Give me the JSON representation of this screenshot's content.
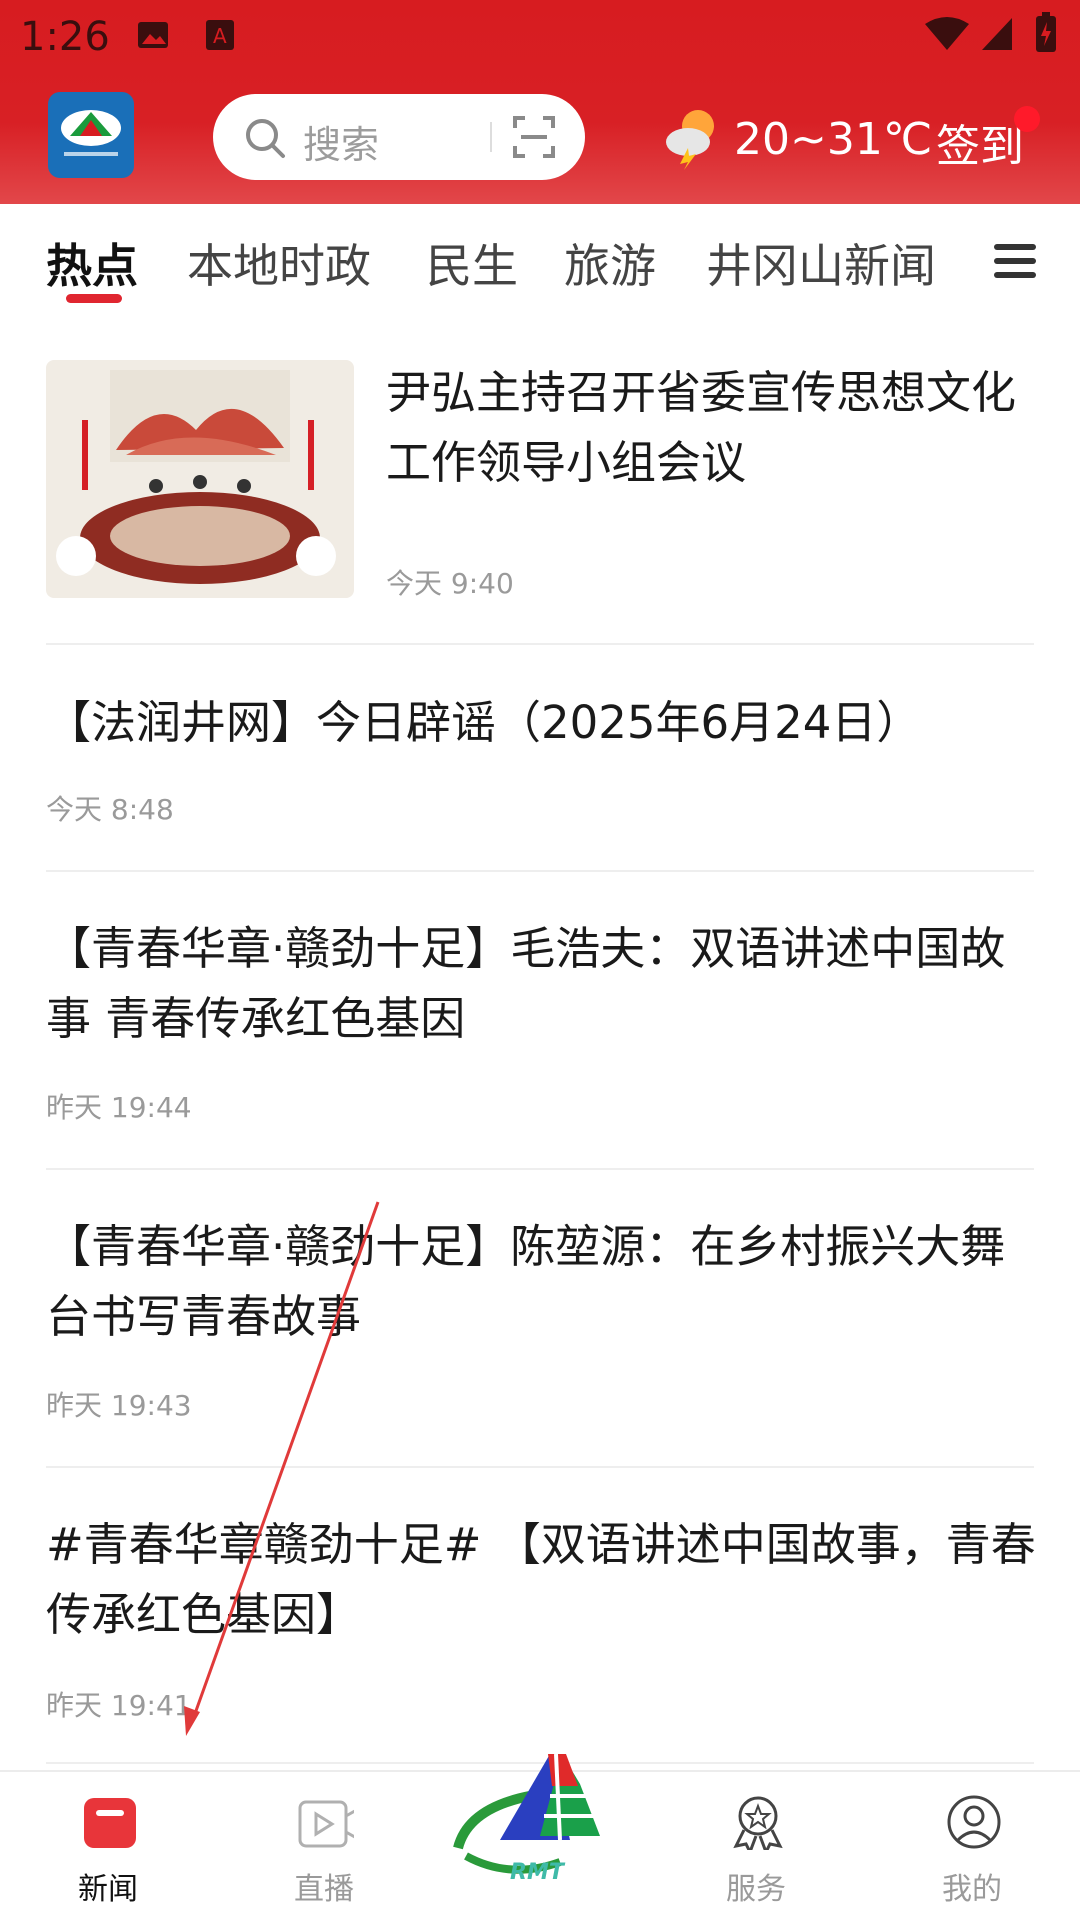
{
  "status_bar": {
    "time": "1:26"
  },
  "header": {
    "search_placeholder": "搜索",
    "weather": "20~31℃",
    "signin_label": "签到"
  },
  "tabs": [
    {
      "label": "热点",
      "active": true
    },
    {
      "label": "本地时政",
      "active": false
    },
    {
      "label": "民生",
      "active": false
    },
    {
      "label": "旅游",
      "active": false
    },
    {
      "label": "井冈山新闻",
      "active": false
    }
  ],
  "news": [
    {
      "title": "尹弘主持召开省委宣传思想文化工作领导小组会议",
      "time": "今天 9:40",
      "has_image": true
    },
    {
      "title": "【法润井网】今日辟谣（2025年6月24日）",
      "time": "今天 8:48"
    },
    {
      "title": "【青春华章·赣劲十足】毛浩夫：双语讲述中国故事 青春传承红色基因",
      "time": "昨天 19:44"
    },
    {
      "title": "【青春华章·赣劲十足】陈堃源：在乡村振兴大舞台书写青春故事",
      "time": "昨天 19:43"
    },
    {
      "title": "#青春华章赣劲十足# 【双语讲述中国故事，青春传承红色基因】",
      "time": "昨天 19:41"
    }
  ],
  "bottom_nav": [
    {
      "label": "新闻",
      "active": true,
      "icon": "news-icon"
    },
    {
      "label": "直播",
      "active": false,
      "icon": "live-icon"
    },
    {
      "label": "服务",
      "active": false,
      "icon": "service-icon"
    },
    {
      "label": "我的",
      "active": false,
      "icon": "profile-icon"
    }
  ],
  "center_logo_text": "RMT",
  "colors": {
    "brand_red": "#d71c20",
    "tab_underline": "#e02630",
    "text_primary": "#1a1a1a",
    "text_muted": "#9a9a9a"
  }
}
